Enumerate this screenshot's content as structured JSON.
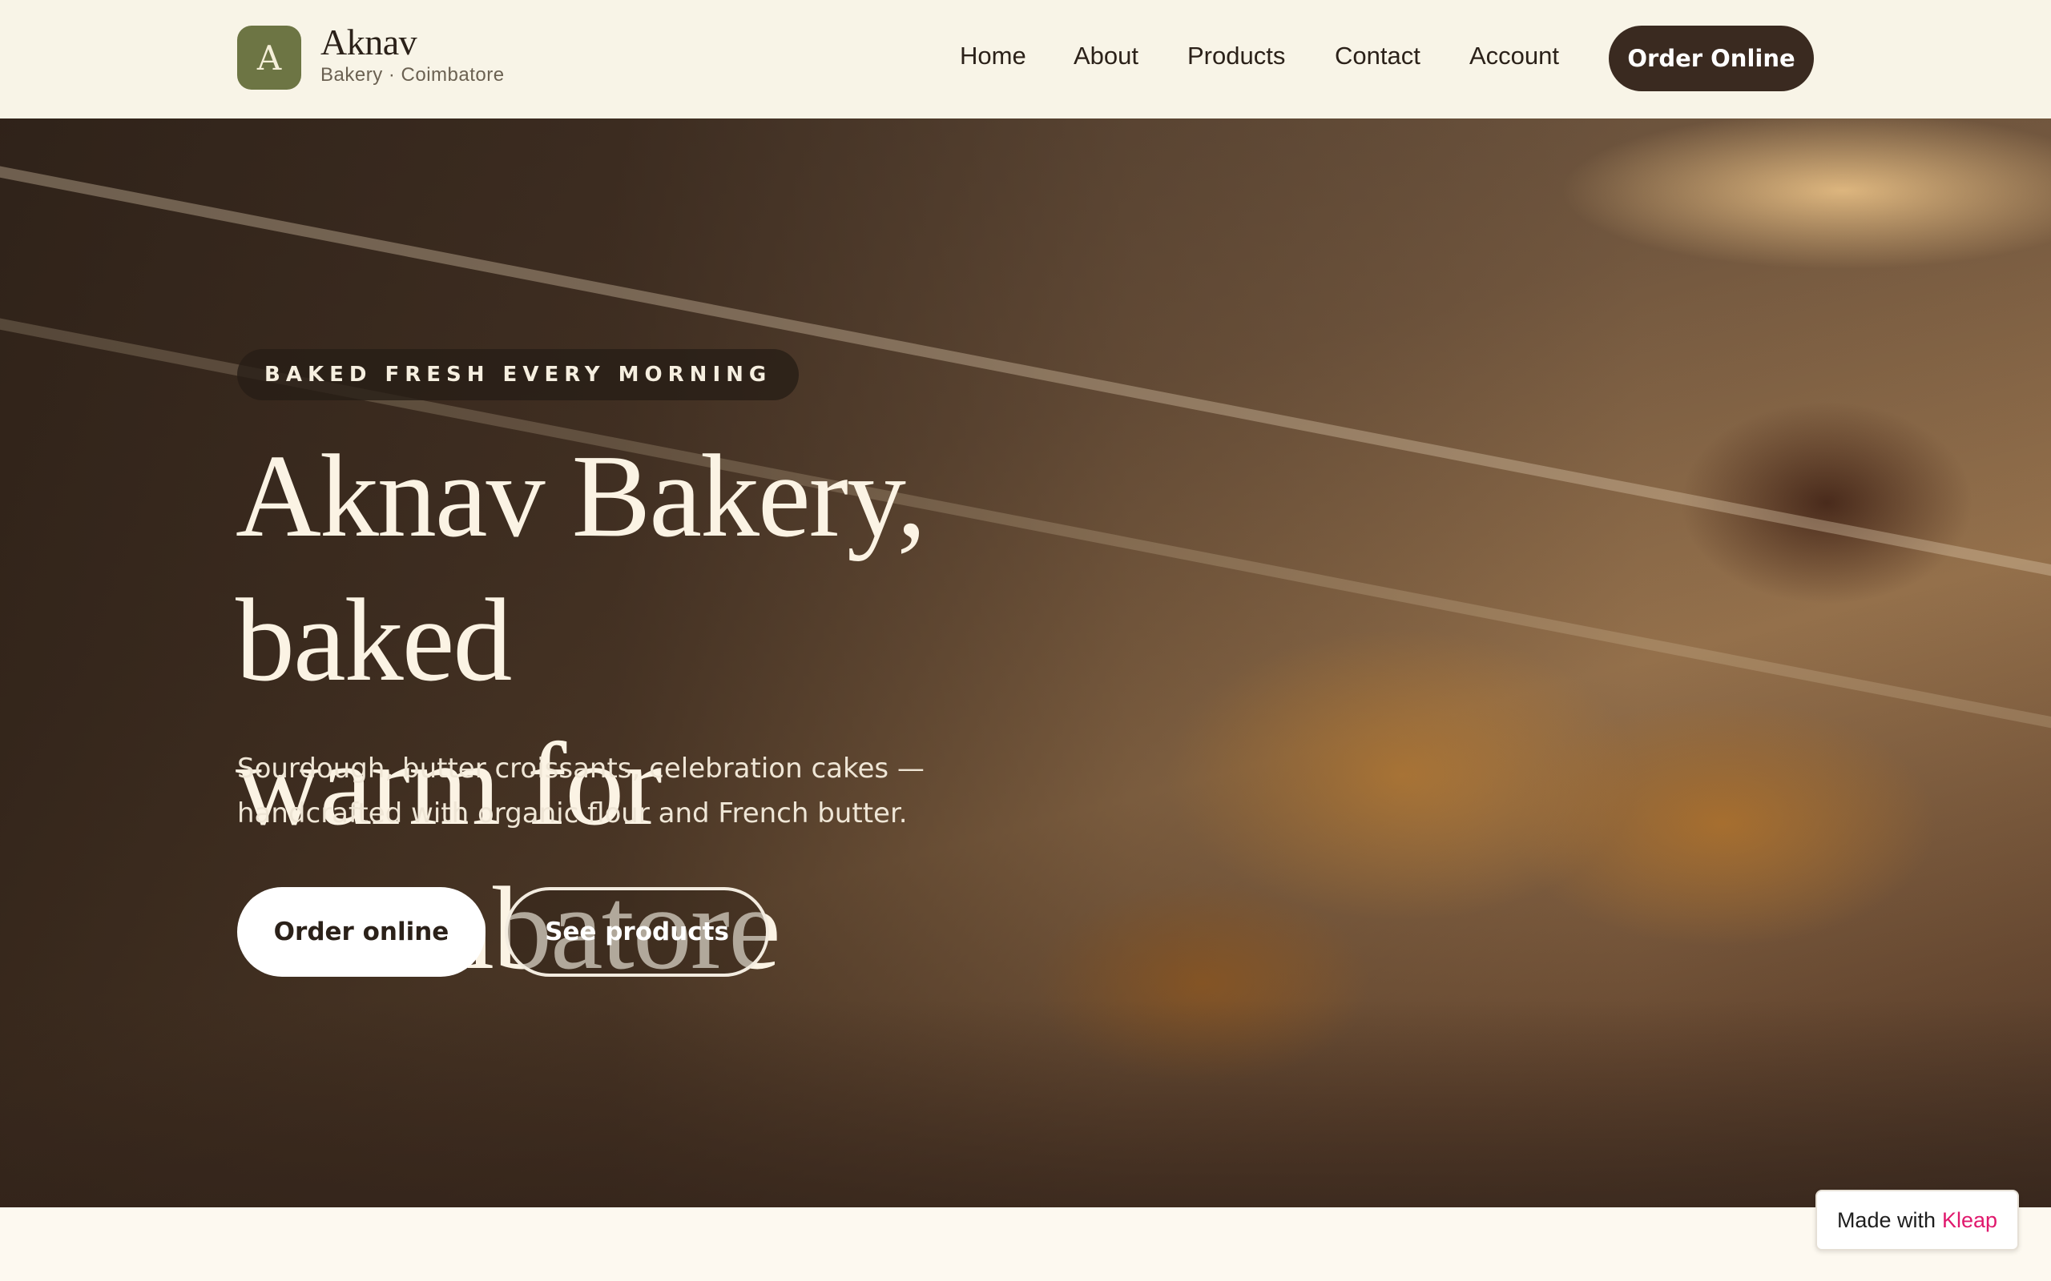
{
  "header": {
    "logo_letter": "A",
    "brand_name": "Aknav",
    "brand_sub": "Bakery · Coimbatore",
    "nav": [
      "Home",
      "About",
      "Products",
      "Contact",
      "Account"
    ],
    "order_button": "Order Online"
  },
  "hero": {
    "tagline": "BAKED FRESH EVERY MORNING",
    "title_line1": "Aknav Bakery, baked",
    "title_line2": "warm for Coimbatore",
    "description_line1": "Sourdough, butter croissants, celebration cakes —",
    "description_line2": "handcrafted with organic flour and French butter.",
    "primary_button": "Order online",
    "secondary_button": "See products"
  },
  "badge": {
    "made_with": "Made with",
    "kleap": "Kleap"
  },
  "colors": {
    "accent_dark": "#3a2a20",
    "logo_green": "#6d7544",
    "header_bg": "#f8f4e7",
    "kleap_pink": "#e0196d"
  }
}
